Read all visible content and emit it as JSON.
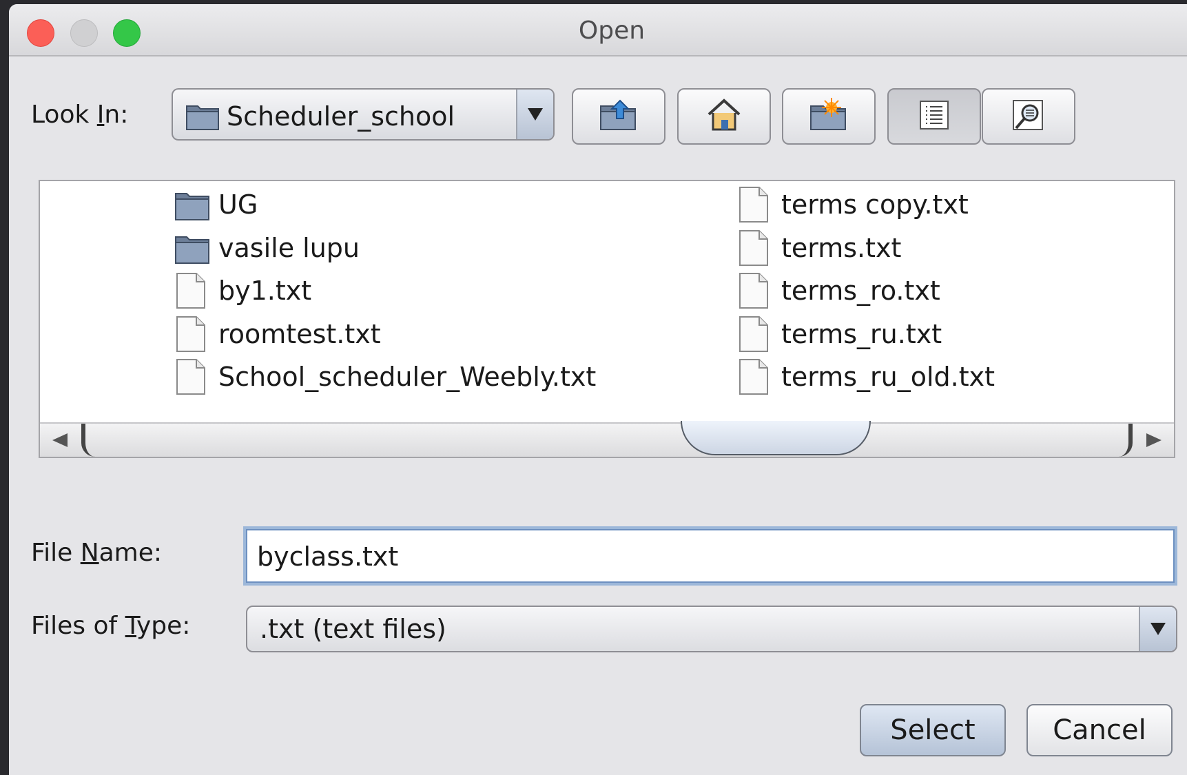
{
  "window": {
    "title": "Open"
  },
  "lookin": {
    "label_pre": "Look ",
    "label_u": "I",
    "label_post": "n:",
    "value": "Scheduler_school"
  },
  "toolbar": {
    "buttons": [
      {
        "icon": "up-folder-icon"
      },
      {
        "icon": "home-icon"
      },
      {
        "icon": "new-folder-icon"
      },
      {
        "icon": "list-view-icon",
        "active": true
      },
      {
        "icon": "details-view-icon"
      }
    ]
  },
  "files": {
    "column1": [
      {
        "name": "UG",
        "type": "folder"
      },
      {
        "name": "vasile lupu",
        "type": "folder"
      },
      {
        "name": "by1.txt",
        "type": "file"
      },
      {
        "name": "roomtest.txt",
        "type": "file"
      },
      {
        "name": "School_scheduler_Weebly.txt",
        "type": "file"
      }
    ],
    "column2": [
      {
        "name": "terms copy.txt",
        "type": "file"
      },
      {
        "name": "terms.txt",
        "type": "file"
      },
      {
        "name": "terms_ro.txt",
        "type": "file"
      },
      {
        "name": "terms_ru.txt",
        "type": "file"
      },
      {
        "name": "terms_ru_old.txt",
        "type": "file"
      }
    ]
  },
  "filename": {
    "label_pre": "File ",
    "label_u": "N",
    "label_post": "ame:",
    "value": "byclass.txt"
  },
  "filetype": {
    "label_pre": "Files of ",
    "label_u": "T",
    "label_post": "ype:",
    "value": ".txt (text files)"
  },
  "actions": {
    "select": "Select",
    "cancel": "Cancel"
  }
}
